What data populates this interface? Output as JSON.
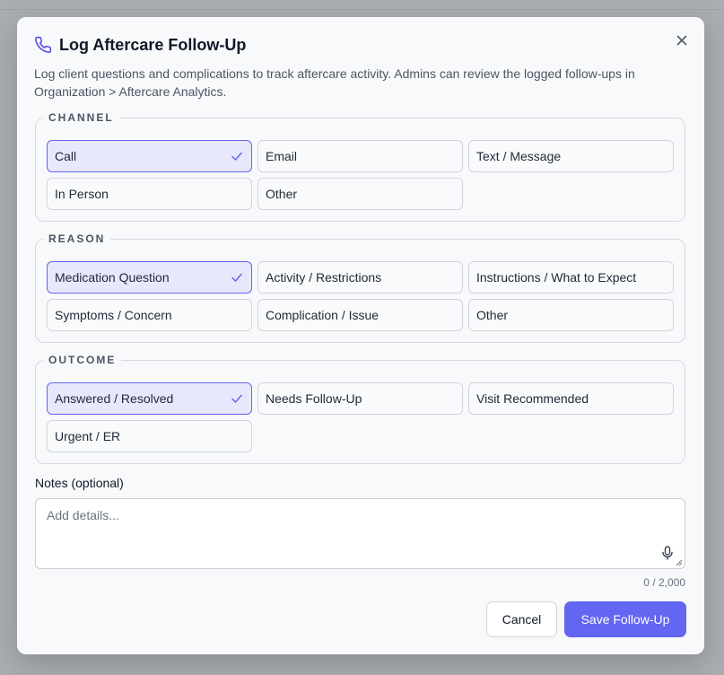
{
  "dialog": {
    "title": "Log Aftercare Follow-Up",
    "description": "Log client questions and complications to track aftercare activity. Admins can review the logged follow-ups in Organization > Aftercare Analytics."
  },
  "channel": {
    "legend": "CHANNEL",
    "options": [
      "Call",
      "Email",
      "Text / Message",
      "In Person",
      "Other"
    ],
    "selected": "Call"
  },
  "reason": {
    "legend": "REASON",
    "options": [
      "Medication Question",
      "Activity / Restrictions",
      "Instructions / What to Expect",
      "Symptoms / Concern",
      "Complication / Issue",
      "Other"
    ],
    "selected": "Medication Question"
  },
  "outcome": {
    "legend": "OUTCOME",
    "options": [
      "Answered / Resolved",
      "Needs Follow-Up",
      "Visit Recommended",
      "Urgent / ER"
    ],
    "selected": "Answered / Resolved"
  },
  "notes": {
    "label": "Notes (optional)",
    "placeholder": "Add details...",
    "value": "",
    "counter": "0 / 2,000"
  },
  "actions": {
    "cancel": "Cancel",
    "save": "Save Follow-Up"
  },
  "colors": {
    "accent": "#6366f1",
    "selected_bg": "#e7e8fb",
    "backdrop": "#a9acb1"
  }
}
